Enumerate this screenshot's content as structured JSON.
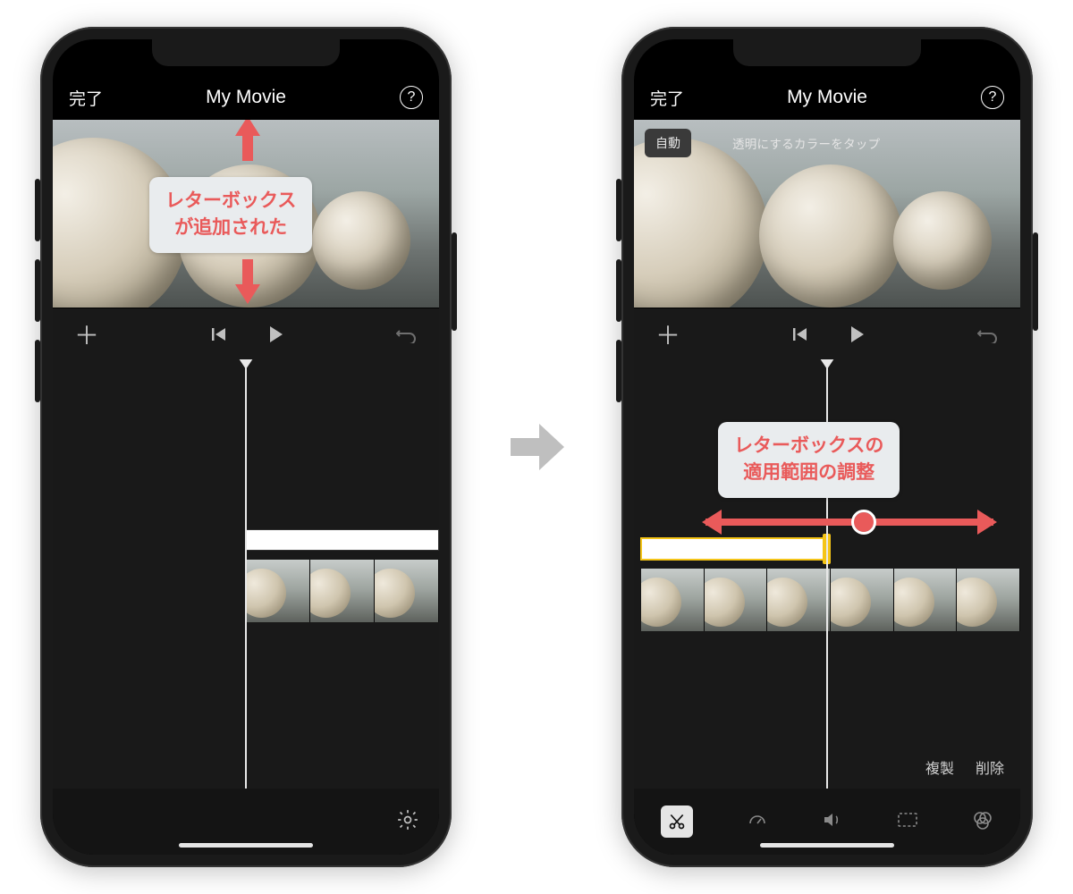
{
  "nav": {
    "done": "完了",
    "title": "My Movie"
  },
  "phoneA": {
    "callout": {
      "line1": "レターボックス",
      "line2": "が追加された"
    }
  },
  "phoneB": {
    "autoChip": "自動",
    "hint": "透明にするカラーをタップ",
    "callout": {
      "line1": "レターボックスの",
      "line2": "適用範囲の調整"
    },
    "actions": {
      "duplicate": "複製",
      "delete": "削除"
    }
  },
  "colors": {
    "accent": "#e95a5a",
    "calloutBg": "#e9ecee",
    "selection": "#f5c518"
  }
}
